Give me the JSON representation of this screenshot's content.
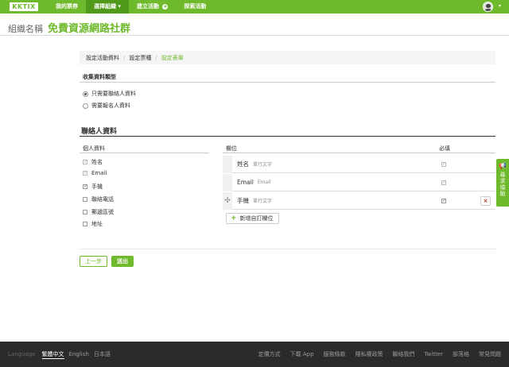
{
  "nav": {
    "logo": "KKTIX",
    "items": [
      {
        "label": "我的票券"
      },
      {
        "label": "選擇組織 ▾"
      },
      {
        "label": "建立活動"
      },
      {
        "label": "探索活動"
      }
    ],
    "avatar_caret": "▾",
    "create_plus": "+"
  },
  "header": {
    "org_label": "組織名稱",
    "org_name": "免費資源網路社群"
  },
  "breadcrumb": {
    "items": [
      "設定活動資料",
      "設定票種",
      "設定表單"
    ],
    "separator": "/"
  },
  "collect": {
    "title": "收集資料類型",
    "options": [
      {
        "label": "只需要聯絡人資料",
        "selected": true
      },
      {
        "label": "需要報名人資料",
        "selected": false
      }
    ]
  },
  "contact": {
    "title": "聯絡人資料",
    "personal_header": "個人資料",
    "personal_fields": [
      {
        "label": "姓名",
        "checked": true,
        "disabled": true
      },
      {
        "label": "Email",
        "checked": true,
        "disabled": true
      },
      {
        "label": "手機",
        "checked": true,
        "disabled": false
      },
      {
        "label": "聯絡電話",
        "checked": false,
        "disabled": false
      },
      {
        "label": "郵遞區號",
        "checked": false,
        "disabled": false
      },
      {
        "label": "地址",
        "checked": false,
        "disabled": false
      }
    ],
    "fields_header": "欄位",
    "required_header": "必填",
    "rows": [
      {
        "name": "姓名",
        "type": "單行文字",
        "required": true
      },
      {
        "name": "Email",
        "type": "Email",
        "required": true
      },
      {
        "name": "手機",
        "type": "單行文字",
        "required": true
      }
    ],
    "drag_icon": "✣",
    "delete_icon": "×",
    "add_button": "新增自訂欄位",
    "add_plus": "+"
  },
  "actions": {
    "prev": "上一步",
    "submit": "送出"
  },
  "feedback": {
    "icon": "📢",
    "label": "尋求協助"
  },
  "footer": {
    "language_label": "Language",
    "languages": [
      {
        "label": "繁體中文",
        "active": true
      },
      {
        "label": "English",
        "active": false
      },
      {
        "label": "日本語",
        "active": false
      }
    ],
    "links": [
      "定價方式",
      "下載 App",
      "服務條款",
      "隱私權政策",
      "聯絡我們",
      "Twitter",
      "部落格",
      "常見問題"
    ]
  },
  "colors": {
    "brand": "#6fb92c",
    "footer_bg": "#2b2b2b"
  }
}
